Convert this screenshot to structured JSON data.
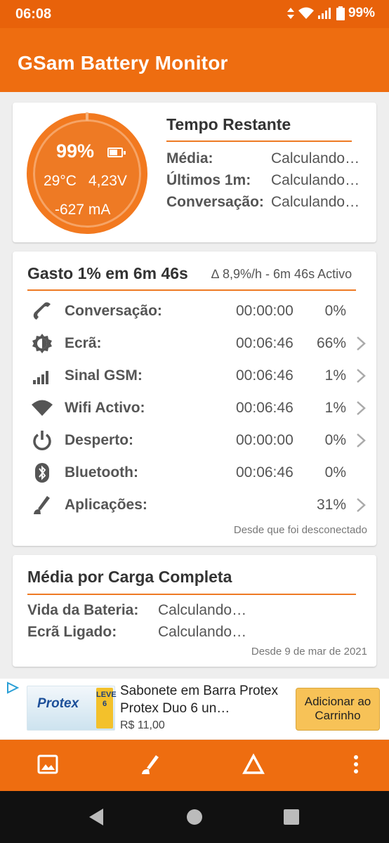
{
  "status_bar": {
    "time": "06:08",
    "battery_pct": "99%"
  },
  "app": {
    "title": "GSam Battery Monitor"
  },
  "summary": {
    "percent": "99%",
    "temperature": "29°C",
    "voltage": "4,23V",
    "current": "-627 mA",
    "title": "Tempo Restante",
    "rows": [
      {
        "label": "Média:",
        "value": "Calculando…"
      },
      {
        "label": "Últimos 1m:",
        "value": "Calculando…"
      },
      {
        "label": "Conversação:",
        "value": "Calculando…"
      }
    ]
  },
  "usage": {
    "title": "Gasto 1% em 6m 46s",
    "subtitle": "∆ 8,9%/h - 6m 46s Activo",
    "rows": [
      {
        "icon": "phone-icon",
        "label": "Conversação:",
        "time": "00:00:00",
        "pct": "0%",
        "chevron": false
      },
      {
        "icon": "brightness-icon",
        "label": "Ecrã:",
        "time": "00:06:46",
        "pct": "66%",
        "chevron": true
      },
      {
        "icon": "signal-icon",
        "label": "Sinal GSM:",
        "time": "00:06:46",
        "pct": "1%",
        "chevron": true
      },
      {
        "icon": "wifi-icon",
        "label": "Wifi Activo:",
        "time": "00:06:46",
        "pct": "1%",
        "chevron": true
      },
      {
        "icon": "power-icon",
        "label": "Desperto:",
        "time": "00:00:00",
        "pct": "0%",
        "chevron": true
      },
      {
        "icon": "bluetooth-icon",
        "label": "Bluetooth:",
        "time": "00:06:46",
        "pct": "0%",
        "chevron": false
      },
      {
        "icon": "apps-icon",
        "label": "Aplicações:",
        "time": "",
        "pct": "31%",
        "chevron": true
      }
    ],
    "note": "Desde que foi desconectado"
  },
  "full_charge": {
    "title": "Média por Carga Completa",
    "rows": [
      {
        "label": "Vida da Bateria:",
        "value": "Calculando…"
      },
      {
        "label": "Ecrã Ligado:",
        "value": "Calculando…"
      }
    ],
    "note": "Desde 9 de mar de 2021"
  },
  "ad": {
    "brand": "Protex",
    "pack_text": "LEVE 6",
    "title": "Sabonete em Barra Protex Protex Duo 6 un…",
    "price": "R$ 11,00",
    "button": "Adicionar ao Carrinho"
  },
  "colors": {
    "accent": "#ee6d10",
    "status": "#e8620a",
    "gauge": "#ee7a24",
    "nav": "#111111"
  }
}
